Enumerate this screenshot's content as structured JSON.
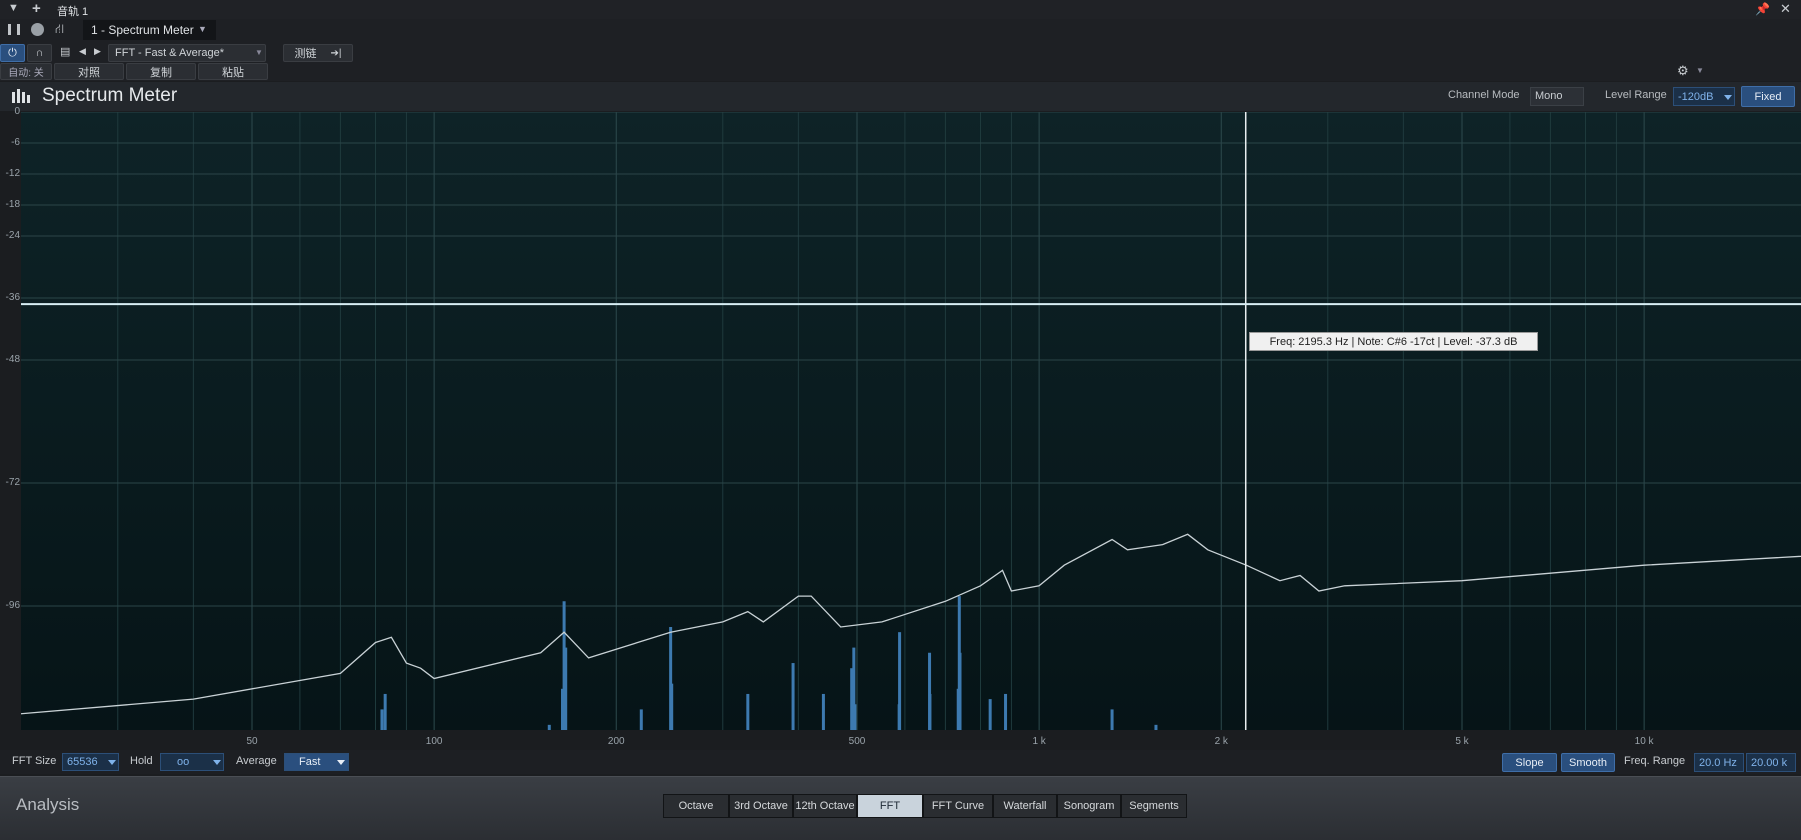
{
  "topbar": {
    "track_title": "音轨 1",
    "device_title": "1 - Spectrum Meter"
  },
  "toolbar": {
    "preset": "FFT - Fast & Average*",
    "sidechain": "测链",
    "auto_label": "自动: 关",
    "compare": "对照",
    "copy": "复制",
    "paste": "粘贴"
  },
  "header": {
    "plugin_name": "Spectrum Meter",
    "channel_mode_label": "Channel Mode",
    "channel_mode": "Mono",
    "level_range_label": "Level Range",
    "level_range": "-120dB",
    "fixed_button": "Fixed"
  },
  "tooltip": "Freq: 2195.3 Hz | Note: C#6 -17ct | Level: -37.3 dB",
  "chart_data": {
    "type": "line",
    "title": "",
    "xlabel": "",
    "ylabel": "",
    "x_scale": "log",
    "xlim": [
      20,
      20000
    ],
    "ylim": [
      -120,
      0
    ],
    "y_ticks": [
      0,
      -6,
      -12,
      -18,
      -24,
      -36,
      -48,
      -72,
      -96
    ],
    "x_ticks": [
      {
        "label": "50",
        "value": 50
      },
      {
        "label": "100",
        "value": 100
      },
      {
        "label": "200",
        "value": 200
      },
      {
        "label": "500",
        "value": 500
      },
      {
        "label": "1 k",
        "value": 1000
      },
      {
        "label": "2 k",
        "value": 2000
      },
      {
        "label": "5 k",
        "value": 5000
      },
      {
        "label": "10 k",
        "value": 10000
      }
    ],
    "cursor": {
      "freq": 2195.3,
      "level": -37.3
    },
    "series": [
      {
        "values": [
          [
            20,
            -117
          ],
          [
            40,
            -114
          ],
          [
            70,
            -109
          ],
          [
            80,
            -103
          ],
          [
            85,
            -102
          ],
          [
            90,
            -107
          ],
          [
            95,
            -108
          ],
          [
            100,
            -110
          ],
          [
            150,
            -105
          ],
          [
            164,
            -101
          ],
          [
            180,
            -106
          ],
          [
            246,
            -101
          ],
          [
            300,
            -99
          ],
          [
            330,
            -97
          ],
          [
            350,
            -99
          ],
          [
            400,
            -94
          ],
          [
            420,
            -94
          ],
          [
            470,
            -100
          ],
          [
            550,
            -99
          ],
          [
            700,
            -95
          ],
          [
            800,
            -92
          ],
          [
            870,
            -89
          ],
          [
            900,
            -93
          ],
          [
            1000,
            -92
          ],
          [
            1100,
            -88
          ],
          [
            1320,
            -83
          ],
          [
            1400,
            -85
          ],
          [
            1600,
            -84
          ],
          [
            1760,
            -82
          ],
          [
            1900,
            -85
          ],
          [
            2200,
            -88
          ],
          [
            2500,
            -91
          ],
          [
            2700,
            -90
          ],
          [
            2900,
            -93
          ],
          [
            3200,
            -92
          ],
          [
            5000,
            -91
          ],
          [
            10000,
            -88
          ],
          [
            20000,
            -86
          ]
        ]
      },
      {
        "type": "bar",
        "values": [
          [
            82,
            -116
          ],
          [
            83,
            -113
          ],
          [
            155,
            -119
          ],
          [
            163,
            -112
          ],
          [
            164,
            -95
          ],
          [
            165,
            -104
          ],
          [
            246,
            -100
          ],
          [
            247,
            -111
          ],
          [
            220,
            -116
          ],
          [
            330,
            -113
          ],
          [
            392,
            -107
          ],
          [
            440,
            -113
          ],
          [
            490,
            -108
          ],
          [
            494,
            -104
          ],
          [
            496,
            -115
          ],
          [
            587,
            -115
          ],
          [
            588,
            -101
          ],
          [
            659,
            -105
          ],
          [
            660,
            -113
          ],
          [
            740,
            -105
          ],
          [
            738,
            -94
          ],
          [
            735,
            -112
          ],
          [
            830,
            -114
          ],
          [
            880,
            -113
          ],
          [
            1320,
            -116
          ],
          [
            1560,
            -119
          ]
        ]
      }
    ]
  },
  "footer": {
    "fft_size_label": "FFT Size",
    "fft_size": "65536",
    "hold_label": "Hold",
    "hold": "oo",
    "average_label": "Average",
    "average": "Fast",
    "slope": "Slope",
    "smooth": "Smooth",
    "freq_range_label": "Freq. Range",
    "freq_min": "20.0 Hz",
    "freq_max": "20.00 k"
  },
  "analysis": {
    "title": "Analysis",
    "modes": [
      {
        "label": "Octave",
        "active": false
      },
      {
        "label": "3rd Octave",
        "active": false
      },
      {
        "label": "12th Octave",
        "active": false
      },
      {
        "label": "FFT",
        "active": true
      },
      {
        "label": "FFT Curve",
        "active": false
      },
      {
        "label": "Waterfall",
        "active": false
      },
      {
        "label": "Sonogram",
        "active": false
      },
      {
        "label": "Segments",
        "active": false
      }
    ]
  }
}
